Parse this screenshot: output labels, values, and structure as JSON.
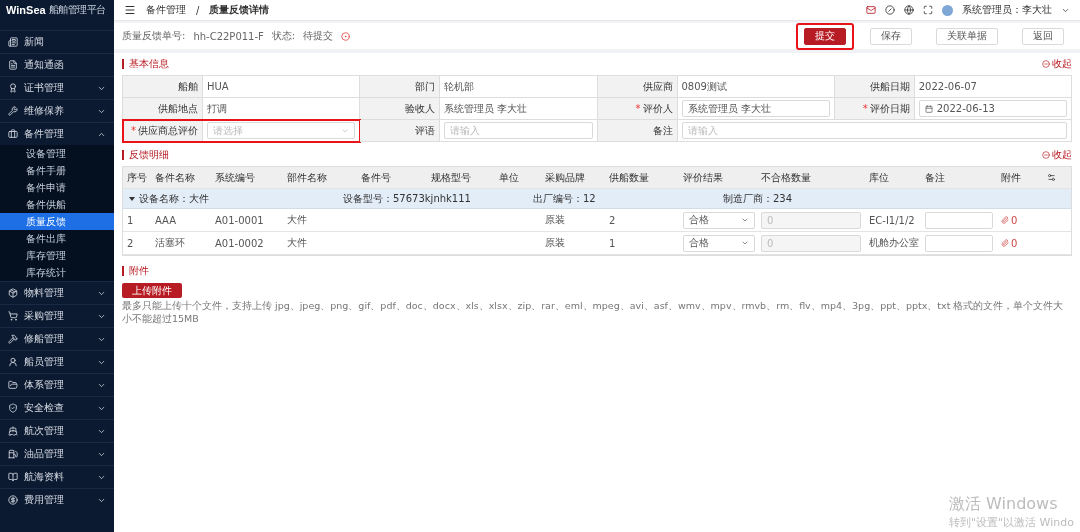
{
  "sidebar": {
    "logo": "WinSea",
    "subtitle": "船舶管理平台",
    "items": [
      {
        "label": "新闻"
      },
      {
        "label": "通知通函"
      },
      {
        "label": "证书管理",
        "expanded": false
      },
      {
        "label": "维修保养",
        "expanded": false
      },
      {
        "label": "备件管理",
        "expanded": true,
        "children": [
          {
            "label": "设备管理",
            "selected": false
          },
          {
            "label": "备件手册",
            "selected": false
          },
          {
            "label": "备件申请",
            "selected": false
          },
          {
            "label": "备件供船",
            "selected": false
          },
          {
            "label": "质量反馈",
            "selected": true
          },
          {
            "label": "备件出库",
            "selected": false
          },
          {
            "label": "库存管理",
            "selected": false
          },
          {
            "label": "库存统计",
            "selected": false
          }
        ]
      },
      {
        "label": "物料管理",
        "expanded": false
      },
      {
        "label": "采购管理",
        "expanded": false
      },
      {
        "label": "修船管理",
        "expanded": false
      },
      {
        "label": "船员管理",
        "expanded": false
      },
      {
        "label": "体系管理",
        "expanded": false
      },
      {
        "label": "安全检查",
        "expanded": false
      },
      {
        "label": "航次管理",
        "expanded": false
      },
      {
        "label": "油品管理",
        "expanded": false
      },
      {
        "label": "航海资料",
        "expanded": false
      },
      {
        "label": "费用管理",
        "expanded": false
      }
    ]
  },
  "topbar": {
    "breadcrumb": [
      "备件管理",
      "质量反馈详情"
    ],
    "breadcrumb_separator": "/",
    "user": "系统管理员：李大壮"
  },
  "header": {
    "order_label": "质量反馈单号:",
    "order_no": "hh-C22P011-F",
    "status_label": "状态:",
    "status": "待提交",
    "buttons": [
      {
        "label": "提交",
        "primary": true,
        "highlighted": true
      },
      {
        "label": "保存",
        "primary": false,
        "highlighted": false
      },
      {
        "label": "关联单据",
        "primary": false,
        "highlighted": false
      },
      {
        "label": "返回",
        "primary": false,
        "highlighted": false
      }
    ]
  },
  "basic_info": {
    "title": "基本信息",
    "collapse": "收起",
    "required_mark": "*",
    "fields": [
      {
        "label": "船舶",
        "kind": "text",
        "value": "HUA",
        "required": false
      },
      {
        "label": "部门",
        "kind": "text",
        "value": "轮机部",
        "required": false
      },
      {
        "label": "供应商",
        "kind": "text",
        "value": "0809测试",
        "required": false
      },
      {
        "label": "供船日期",
        "kind": "text",
        "value": "2022-06-07",
        "required": false
      },
      {
        "label": "供船地点",
        "kind": "text",
        "value": "打调",
        "required": false
      },
      {
        "label": "验收人",
        "kind": "text",
        "value": "系统管理员 李大壮",
        "required": false
      },
      {
        "label": "评价人",
        "kind": "input",
        "value": "系统管理员 李大壮",
        "required": true
      },
      {
        "label": "评价日期",
        "kind": "date",
        "value": "2022-06-13",
        "required": true
      },
      {
        "label": "供应商总评价",
        "kind": "select",
        "placeholder": "请选择",
        "required": true,
        "highlighted": true
      },
      {
        "label": "评语",
        "kind": "input",
        "placeholder": "请输入",
        "required": false
      },
      {
        "label": "备注",
        "kind": "input",
        "placeholder": "请输入",
        "required": false,
        "wide": true
      }
    ]
  },
  "feedback": {
    "title": "反馈明细",
    "collapse": "收起",
    "columns": [
      "序号",
      "备件名称",
      "系统编号",
      "部件名称",
      "备件号",
      "规格型号",
      "单位",
      "采购品牌",
      "供船数量",
      "评价结果",
      "不合格数量",
      "库位",
      "备注",
      "附件"
    ],
    "group": {
      "expanded": true,
      "fields": [
        {
          "label": "设备名称：",
          "value": "大件"
        },
        {
          "label": "设备型号：",
          "value": "57673kjnhk111"
        },
        {
          "label": "出厂编号：",
          "value": "12"
        },
        {
          "label": "制造厂商：",
          "value": "234"
        }
      ]
    },
    "rows": [
      {
        "no": "1",
        "name": "AAA",
        "code": "A01-0001",
        "part": "大件",
        "brand": "原装",
        "qty": "2",
        "result": "合格",
        "unqualified": "0",
        "location": "EC-I1/1/2",
        "attachments": "0"
      },
      {
        "no": "2",
        "name": "活塞环",
        "code": "A01-0002",
        "part": "大件",
        "brand": "原装",
        "qty": "1",
        "result": "合格",
        "unqualified": "0",
        "location": "机舱办公室",
        "attachments": "0"
      }
    ]
  },
  "attachments": {
    "title": "附件",
    "button": "上传附件",
    "hint": "最多只能上传十个文件，支持上传 jpg、jpeg、png、gif、pdf、doc、docx、xls、xlsx、zip、rar、eml、mpeg、avi、asf、wmv、mpv、rmvb、rm、flv、mp4、3pg、ppt、pptx、txt 格式的文件，单个文件大小不能超过15MB"
  },
  "activation": {
    "title": "激活 Windows",
    "subtitle": "转到\"设置\"以激活 Windo"
  }
}
